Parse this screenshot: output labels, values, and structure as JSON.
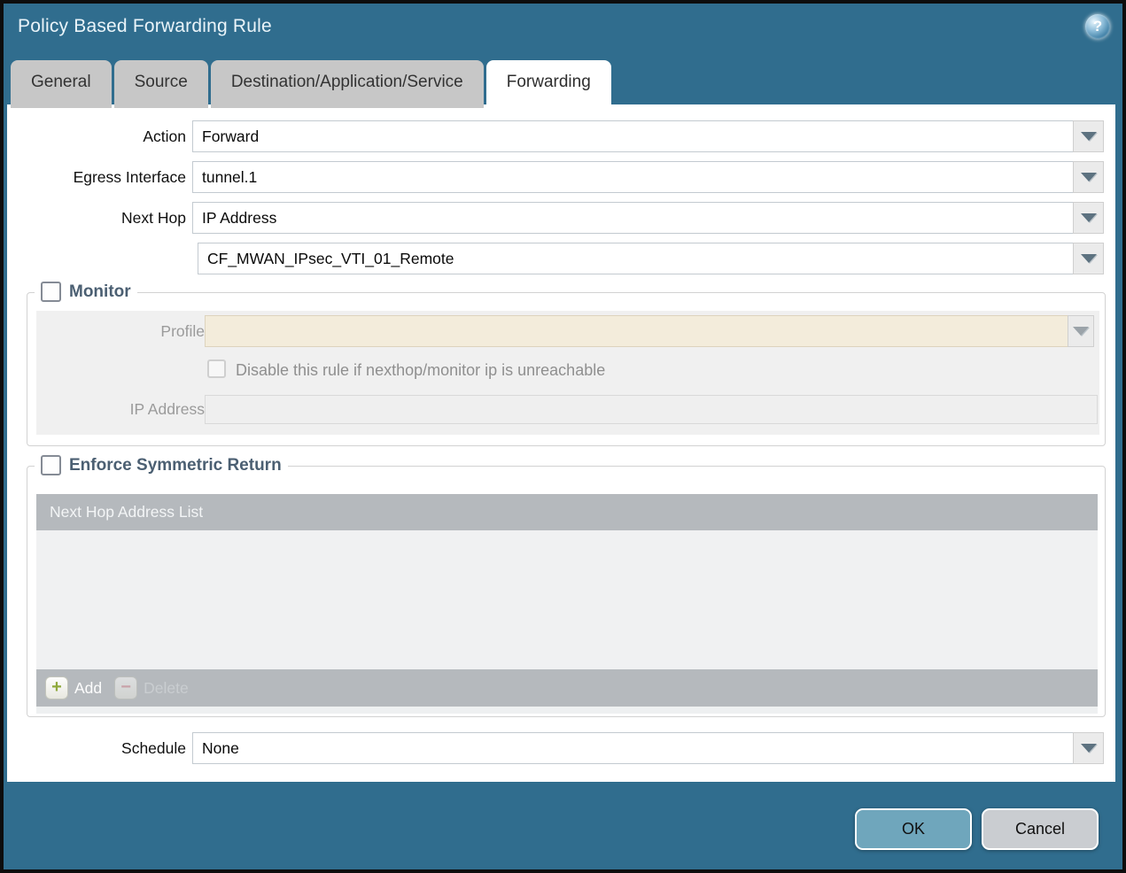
{
  "window": {
    "title": "Policy Based Forwarding Rule",
    "help_icon": "?"
  },
  "tabs": [
    {
      "label": "General",
      "active": false
    },
    {
      "label": "Source",
      "active": false
    },
    {
      "label": "Destination/Application/Service",
      "active": false
    },
    {
      "label": "Forwarding",
      "active": true
    }
  ],
  "form": {
    "action": {
      "label": "Action",
      "value": "Forward"
    },
    "egress_interface": {
      "label": "Egress Interface",
      "value": "tunnel.1"
    },
    "next_hop": {
      "label": "Next Hop",
      "value": "IP Address"
    },
    "next_hop_address": {
      "value": "CF_MWAN_IPsec_VTI_01_Remote"
    },
    "schedule": {
      "label": "Schedule",
      "value": "None"
    }
  },
  "monitor": {
    "legend": "Monitor",
    "checkbox_checked": false,
    "profile": {
      "label": "Profile",
      "value": ""
    },
    "disable_rule_label": "Disable this rule if nexthop/monitor ip is unreachable",
    "disable_rule_checked": false,
    "ip_address": {
      "label": "IP Address",
      "value": ""
    }
  },
  "symmetric_return": {
    "legend": "Enforce Symmetric Return",
    "checkbox_checked": false,
    "table_header": "Next Hop Address List",
    "rows": [],
    "add_label": "Add",
    "delete_label": "Delete",
    "add_icon": "+",
    "delete_icon": "−"
  },
  "footer": {
    "ok_label": "OK",
    "cancel_label": "Cancel"
  },
  "colors": {
    "titlebar_teal": "#306d8e",
    "ok_button": "#6fa6bc",
    "cancel_button": "#cacdd1",
    "profile_disabled_bg": "#f3ecdb",
    "grid_gray": "#b5b9bd"
  }
}
